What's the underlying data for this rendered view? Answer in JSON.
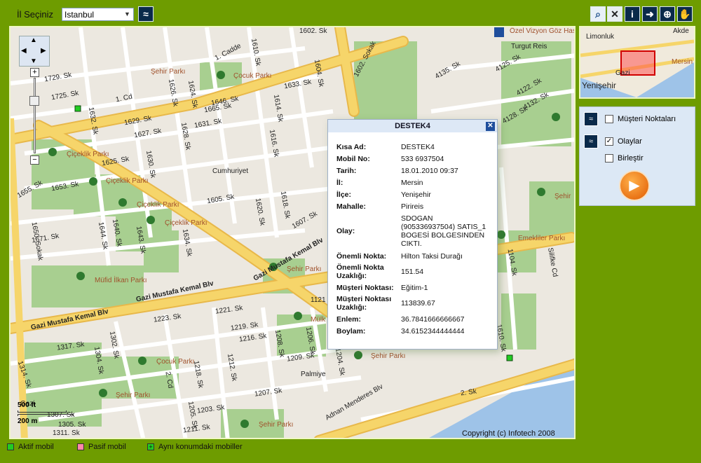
{
  "topbar": {
    "city_label": "İl Seçiniz",
    "city_value": "Istanbul",
    "toolbar_icons": [
      "zoom-extent-icon",
      "clear-icon",
      "info-icon",
      "arrow-right-icon",
      "zoom-in-icon",
      "pan-hand-icon"
    ]
  },
  "map": {
    "street_labels": [
      "1602. Sk",
      "1. Cadde",
      "1729. Sk",
      "1725. Sk",
      "1. Cd",
      "1632. Sk",
      "1629. Sk",
      "1627. Sk",
      "1625. Sk",
      "1630. Sk",
      "1628. Sk",
      "1631. Sk",
      "1633. Sk",
      "1614. Sk",
      "1616. Sk",
      "1610. Sk",
      "1604. Sk",
      "1602. Sokak",
      "1605. Sk",
      "1618. Sk",
      "1620. Sk",
      "1655. Sk",
      "1653. Sk",
      "1650. Sokak",
      "1671. Sk",
      "1644. Sk",
      "1643. Sk",
      "1640. Sk",
      "1634. Sk",
      "1607. Sk",
      "1646. Sk",
      "1665. Sk",
      "1624. Sk",
      "1626. Sk",
      "Cumhuriyet",
      "Gazi Mustafa Kemal Blv",
      "Gazi Mustafa Kemal Blv",
      "Gazi Mustafa Kemal Blv",
      "1223. Sk",
      "1221. Sk",
      "1219. Sk",
      "1216. Sk",
      "1317. Sk",
      "1302. Sk",
      "1304. Sk",
      "1208. Sk",
      "1209. Sk",
      "1212. Sk",
      "1218. Sk",
      "1203. Sk",
      "1207. Sk",
      "1211. Sk",
      "1205. Sk",
      "1307. Sk",
      "1305. Sk",
      "1314. Sk",
      "2. Cd",
      "Palmiye",
      "Adnan Menderes Blv",
      "Turgut Reis",
      "4125. Sk",
      "4135. Sk",
      "4122. Sk",
      "4132. Sk",
      "4128. Sk",
      "1104. Sk",
      "Silifke Cd",
      "Gazi",
      "1311. Sk",
      "1121",
      "1204. Sk",
      "1206. Sk",
      "1610. Sk",
      "2. Sk"
    ],
    "park_labels": [
      "Şehir Parkı",
      "Çocuk Parkı",
      "Çiçeklik Parkı",
      "Çiçeklik Parkı",
      "Çiçeklik Parkı",
      "Çiçeklik Parkı",
      "Müfid İlkan Parkı",
      "Şehir Parkı",
      "Mülk",
      "Çocuk Parkı",
      "Şehir Parkı",
      "Şehir Parkı",
      "Şehir Parkı",
      "Emekliler Parkı",
      "Şehir"
    ],
    "poi_labels": [
      "Özel Vizyon Göz Hastanesi"
    ],
    "scale": {
      "place": "Gazi",
      "ft": "500 ft",
      "m": "200 m"
    },
    "copyright": "Copyright (c) Infotech 2008"
  },
  "popup": {
    "title": "DESTEK4",
    "rows": [
      {
        "k": "Kısa Ad:",
        "v": "DESTEK4"
      },
      {
        "k": "Mobil No:",
        "v": "533 6937504"
      },
      {
        "k": "Tarih:",
        "v": "18.01.2010 09:37"
      },
      {
        "k": "İl:",
        "v": "Mersin"
      },
      {
        "k": "İlçe:",
        "v": "Yenişehir"
      },
      {
        "k": "Mahalle:",
        "v": "Pirireis"
      },
      {
        "k": "Olay:",
        "v": "SDOGAN (905336937504) SATIS_1 BOGESİ BOLGESINDEN CIKTI."
      },
      {
        "k": "Önemli Nokta:",
        "v": "Hilton Taksi Durağı"
      },
      {
        "k": "Önemli Nokta Uzaklığı:",
        "v": "151.54"
      },
      {
        "k": "Müşteri Noktası:",
        "v": "Eğitim-1"
      },
      {
        "k": "Müşteri Noktası Uzaklığı:",
        "v": "113839.67"
      },
      {
        "k": "Enlem:",
        "v": "36.7841666666667"
      },
      {
        "k": "Boylam:",
        "v": "34.6152344444444"
      }
    ]
  },
  "overview": {
    "labels": [
      "Limonluk",
      "Akde",
      "Mersin",
      "Gazi",
      "Yenişehir"
    ]
  },
  "panel": {
    "items": [
      {
        "label": "Müşteri Noktaları",
        "checked": false
      },
      {
        "label": "Olaylar",
        "checked": true
      },
      {
        "label": "Birleştir",
        "checked": false
      }
    ],
    "check_mark": "✓"
  },
  "legend": {
    "items": [
      {
        "label": "Aktif mobil",
        "color": "#22cc22"
      },
      {
        "label": "Pasif mobil",
        "color": "#ff88aa"
      },
      {
        "label": "Aynı konumdaki mobiller",
        "color": "#22cc22"
      }
    ]
  },
  "colors": {
    "background": "#6e9c00",
    "road_major": "#f6d56a",
    "park": "#a8cf90",
    "sea": "#9ec3e8"
  }
}
